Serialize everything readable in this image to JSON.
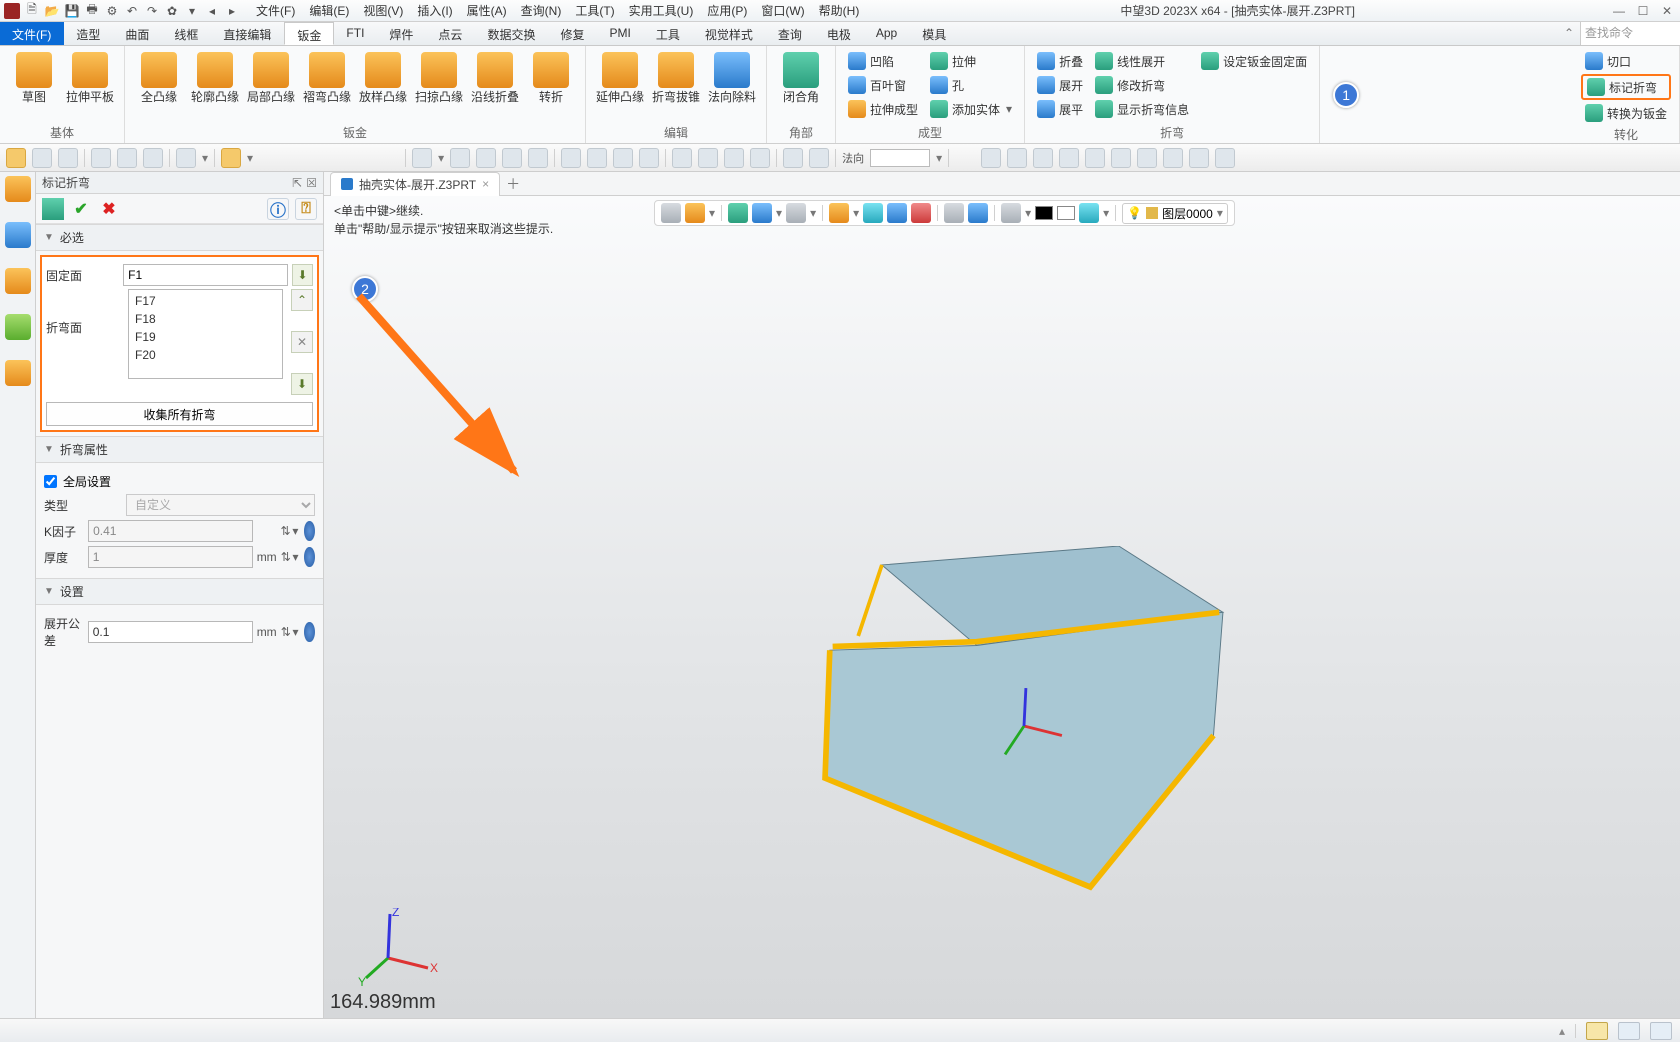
{
  "app": {
    "title": "中望3D 2023X x64 - [抽壳实体-展开.Z3PRT]"
  },
  "qat_icons": [
    "app",
    "new",
    "open",
    "save",
    "print",
    "cfg",
    "undo",
    "redo",
    "gear",
    "drop"
  ],
  "menubar": [
    "文件(F)",
    "编辑(E)",
    "视图(V)",
    "插入(I)",
    "属性(A)",
    "查询(N)",
    "工具(T)",
    "实用工具(U)",
    "应用(P)",
    "窗口(W)",
    "帮助(H)"
  ],
  "ribbon_tabs": [
    "文件(F)",
    "造型",
    "曲面",
    "线框",
    "直接编辑",
    "钣金",
    "FTI",
    "焊件",
    "点云",
    "数据交换",
    "修复",
    "PMI",
    "工具",
    "视觉样式",
    "查询",
    "电极",
    "App",
    "模具"
  ],
  "active_file_tab": 0,
  "selected_ribbon_tab": 5,
  "find_placeholder": "查找命令",
  "groups": {
    "g1": {
      "label": "基体",
      "items": [
        "草图",
        "拉伸平板"
      ]
    },
    "g2": {
      "label": "钣金",
      "items": [
        "全凸缘",
        "轮廓凸缘",
        "局部凸缘",
        "褶弯凸缘",
        "放样凸缘",
        "扫掠凸缘",
        "沿线折叠",
        "转折"
      ]
    },
    "g3": {
      "label": "编辑",
      "items": [
        "延伸凸缘",
        "折弯拔锥",
        "法向除料"
      ]
    },
    "g4": {
      "label": "角部",
      "items": [
        "闭合角"
      ]
    },
    "g5": {
      "label": "成型",
      "cols": [
        [
          "凹陷",
          "百叶窗",
          "拉伸成型"
        ],
        [
          "拉伸",
          "孔",
          "添加实体"
        ]
      ]
    },
    "g6": {
      "label": "折弯",
      "cols": [
        [
          "折叠",
          "展开",
          "展平"
        ],
        [
          "线性展开",
          "修改折弯",
          "显示折弯信息"
        ]
      ],
      "right": [
        "设定钣金固定面"
      ]
    },
    "g7": {
      "label": "转化",
      "items": [
        "切口",
        "标记折弯",
        "转换为钣金"
      ]
    }
  },
  "annot": {
    "one": "1",
    "two": "2"
  },
  "mini_tb": {
    "direction_label": "法向"
  },
  "panel": {
    "title": "标记折弯",
    "sections": {
      "req": "必选",
      "prop": "折弯属性",
      "set": "设置"
    },
    "fixed_face_label": "固定面",
    "fixed_face_value": "F1",
    "bend_face_label": "折弯面",
    "bend_faces": [
      "F17",
      "F18",
      "F19",
      "F20"
    ],
    "collect_btn": "收集所有折弯",
    "global_label": "全局设置",
    "type_label": "类型",
    "type_value": "自定义",
    "k_label": "K因子",
    "k_value": "0.41",
    "thick_label": "厚度",
    "thick_value": "1",
    "thick_unit": "mm",
    "tol_label": "展开公差",
    "tol_value": "0.1",
    "tol_unit": "mm"
  },
  "doc_tabs": [
    {
      "label": "抽壳实体-展开.Z3PRT"
    }
  ],
  "canvas_hints": [
    "<单击中键>继续.",
    "单击\"帮助/显示提示\"按钮来取消这些提示."
  ],
  "layer": {
    "label": "图层0000"
  },
  "axes": {
    "x": "X",
    "y": "Y",
    "z": "Z"
  },
  "dimension": "164.989mm"
}
